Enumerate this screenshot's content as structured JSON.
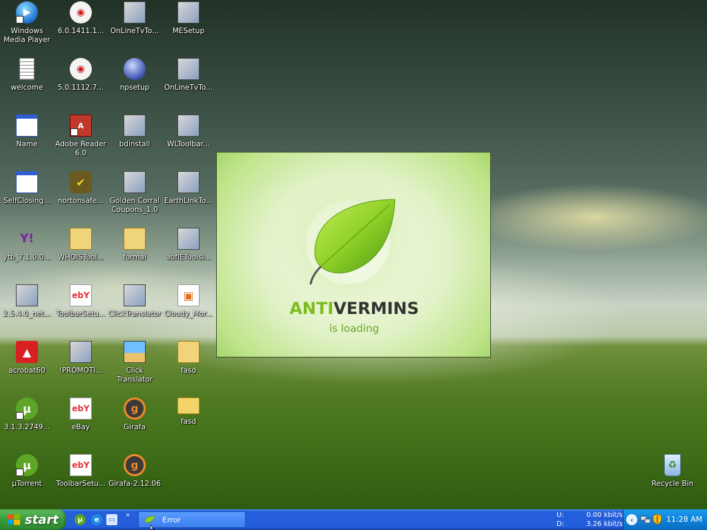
{
  "desktop": {
    "icons": [
      {
        "label": "Windows\nMedia Player",
        "icon": "windows-media-player-icon",
        "glyph": "▶"
      },
      {
        "label": "welcome",
        "icon": "text-document-icon",
        "glyph": ""
      },
      {
        "label": "Name",
        "icon": "application-window-icon",
        "glyph": ""
      },
      {
        "label": "SelfClosing...",
        "icon": "application-window-icon",
        "glyph": ""
      },
      {
        "label": "ytb_7.1.0.0...",
        "icon": "yahoo-icon",
        "glyph": "Y!"
      },
      {
        "label": "2.5.4.0_net...",
        "icon": "setup-installer-icon",
        "glyph": ""
      },
      {
        "label": "acrobat60",
        "icon": "acrobat-icon",
        "glyph": "▲"
      },
      {
        "label": "3.1.3.2749...",
        "icon": "utorrent-icon",
        "glyph": "µ"
      },
      {
        "label": "µTorrent",
        "icon": "utorrent-icon",
        "glyph": "µ"
      },
      {
        "label": "6.0.1411.1...",
        "icon": "ccleaner-icon",
        "glyph": "◉"
      },
      {
        "label": "5.0.1112.7...",
        "icon": "ccleaner-icon",
        "glyph": "◉"
      },
      {
        "label": "Adobe Reader\n6.0",
        "icon": "adobe-reader-icon",
        "glyph": "A"
      },
      {
        "label": "nortonsafe...",
        "icon": "norton-icon",
        "glyph": "✔"
      },
      {
        "label": "WHOISTool...",
        "icon": "zip-folder-icon",
        "glyph": ""
      },
      {
        "label": "ToolbarSetu...",
        "icon": "ebay-icon",
        "glyph": "ebY"
      },
      {
        "label": "!PROMOTI...",
        "icon": "setup-installer-icon",
        "glyph": ""
      },
      {
        "label": "eBay",
        "icon": "ebay-icon",
        "glyph": "ebY"
      },
      {
        "label": "ToolbarSetu...",
        "icon": "ebay-icon",
        "glyph": "ebY"
      },
      {
        "label": "OnLineTvTo...",
        "icon": "setup-package-icon",
        "glyph": ""
      },
      {
        "label": "npsetup",
        "icon": "netscape-icon",
        "glyph": ""
      },
      {
        "label": "bdinstall",
        "icon": "setup-installer-icon",
        "glyph": ""
      },
      {
        "label": "Golden Corral\nCoupons_1.0",
        "icon": "setup-installer-icon",
        "glyph": ""
      },
      {
        "label": "formai",
        "icon": "zip-folder-icon",
        "glyph": ""
      },
      {
        "label": "ClickTranslator",
        "icon": "setup-installer-icon",
        "glyph": ""
      },
      {
        "label": "Click\nTranslator",
        "icon": "click-translator-icon",
        "glyph": ""
      },
      {
        "label": "Girafa",
        "icon": "girafa-icon",
        "glyph": "g"
      },
      {
        "label": "Girafa-2.12.06",
        "icon": "girafa-icon",
        "glyph": "g"
      },
      {
        "label": "MESetup",
        "icon": "setup-installer-icon",
        "glyph": ""
      },
      {
        "label": "OnLineTvTo...",
        "icon": "setup-package-icon",
        "glyph": ""
      },
      {
        "label": "WLToolbar...",
        "icon": "setup-package-icon",
        "glyph": ""
      },
      {
        "label": "EarthLinkTo...",
        "icon": "setup-installer-icon",
        "glyph": ""
      },
      {
        "label": "abfIEToolsI...",
        "icon": "setup-installer-icon",
        "glyph": ""
      },
      {
        "label": "Cloudy_Mor...",
        "icon": "paint-image-icon",
        "glyph": "▣"
      },
      {
        "label": "fasd",
        "icon": "zip-folder-icon",
        "glyph": ""
      },
      {
        "label": "fasd",
        "icon": "folder-icon",
        "glyph": ""
      },
      {
        "label": "Recycle Bin",
        "icon": "recycle-bin-icon",
        "glyph": "♻"
      }
    ]
  },
  "splash": {
    "brand_part1": "ANTI",
    "brand_part2": "VERMINS",
    "status": "is loading",
    "brand_green": "#7dbb1f",
    "brand_dark": "#333333"
  },
  "taskbar": {
    "start_label": "start",
    "quick_launch_more": "»",
    "task_label": "Error",
    "net_meter": {
      "upload_label": "U:",
      "upload_value": "0.00 kbit/s",
      "download_label": "D:",
      "download_value": "3.26 kbit/s"
    },
    "clock": "11:28 AM",
    "tray_expand": "‹"
  }
}
